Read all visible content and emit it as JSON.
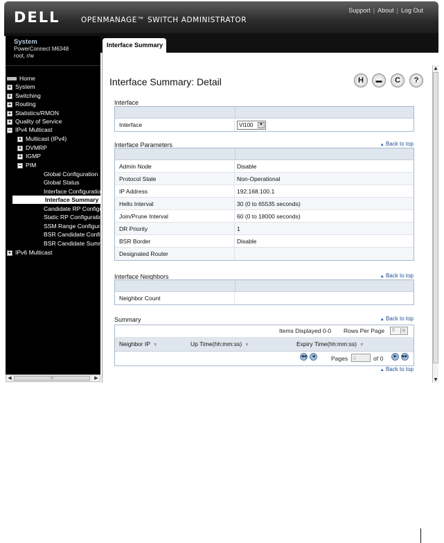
{
  "header": {
    "logo": "DELL",
    "product": "OPENMANAGE™ SWITCH ADMINISTRATOR",
    "links": [
      "Support",
      "About",
      "Log Out"
    ]
  },
  "system": {
    "title": "System",
    "model": "PowerConnect M6348",
    "user": "root, r/w"
  },
  "nav": {
    "items": [
      {
        "label": "Home",
        "toggle": "",
        "icon": "home"
      },
      {
        "label": "System",
        "toggle": "+"
      },
      {
        "label": "Switching",
        "toggle": "+"
      },
      {
        "label": "Routing",
        "toggle": "+"
      },
      {
        "label": "Statistics/RMON",
        "toggle": "+"
      },
      {
        "label": "Quality of Service",
        "toggle": "+"
      },
      {
        "label": "IPv4 Multicast",
        "toggle": "−"
      },
      {
        "label": "Multicast (IPv4)",
        "toggle": "+"
      },
      {
        "label": "DVMRP",
        "toggle": "+"
      },
      {
        "label": "IGMP",
        "toggle": "+"
      },
      {
        "label": "PIM",
        "toggle": "−"
      },
      {
        "label": "Global Configuration",
        "toggle": ""
      },
      {
        "label": "Global Status",
        "toggle": ""
      },
      {
        "label": "Interface Configuration",
        "toggle": ""
      },
      {
        "label": "Interface Summary",
        "toggle": "",
        "active": true
      },
      {
        "label": "Candidate RP Configuration",
        "toggle": ""
      },
      {
        "label": "Static RP Configuration",
        "toggle": ""
      },
      {
        "label": "SSM Range Configuration",
        "toggle": ""
      },
      {
        "label": "BSR Candidate Configuration",
        "toggle": ""
      },
      {
        "label": "BSR Candidate Summary",
        "toggle": ""
      },
      {
        "label": "IPv6 Multicast",
        "toggle": "+"
      }
    ],
    "hscroll_middle": "III"
  },
  "tab": {
    "label": "Interface Summary"
  },
  "page": {
    "title": "Interface Summary: Detail",
    "toolbar_icons": [
      "save-icon",
      "print-icon",
      "refresh-icon",
      "help-icon"
    ],
    "toolbar_glyphs": [
      "H",
      "▬",
      "C",
      "?"
    ]
  },
  "interface_section": {
    "label": "Interface",
    "field_label": "Interface",
    "field_value": "Vl100"
  },
  "params_section": {
    "label": "Interface Parameters",
    "back": "Back to top",
    "rows": [
      {
        "key": "Admin Node",
        "value": "Disable"
      },
      {
        "key": "Protocol State",
        "value": "Non-Operational"
      },
      {
        "key": "IP Address",
        "value": "192.168.100.1"
      },
      {
        "key": "Hello Interval",
        "value": "30  (0 to 65535 seconds)"
      },
      {
        "key": "Join/Prune Interval",
        "value": "60  (0 to 18000 seconds)"
      },
      {
        "key": "DR Priority",
        "value": "1"
      },
      {
        "key": "BSR Border",
        "value": "Disable"
      },
      {
        "key": "Designated Router",
        "value": ""
      }
    ]
  },
  "neighbors_section": {
    "label": "Interface Neighbors",
    "back": "Back to top",
    "count_label": "Neighbor Count",
    "count_value": ""
  },
  "summary_section": {
    "label": "Summary",
    "back": "Back to top",
    "items_displayed": "Items Displayed 0-0",
    "rows_per_page_label": "Rows Per Page",
    "rows_per_page_value": "0",
    "columns": [
      "Neighbor IP",
      "Up Time(hh:mm:ss)",
      "Expiry Time(hh:mm:ss)"
    ],
    "pages_label": "Pages",
    "page_value": "0",
    "of_label": "of 0",
    "back_bottom": "Back to top"
  }
}
